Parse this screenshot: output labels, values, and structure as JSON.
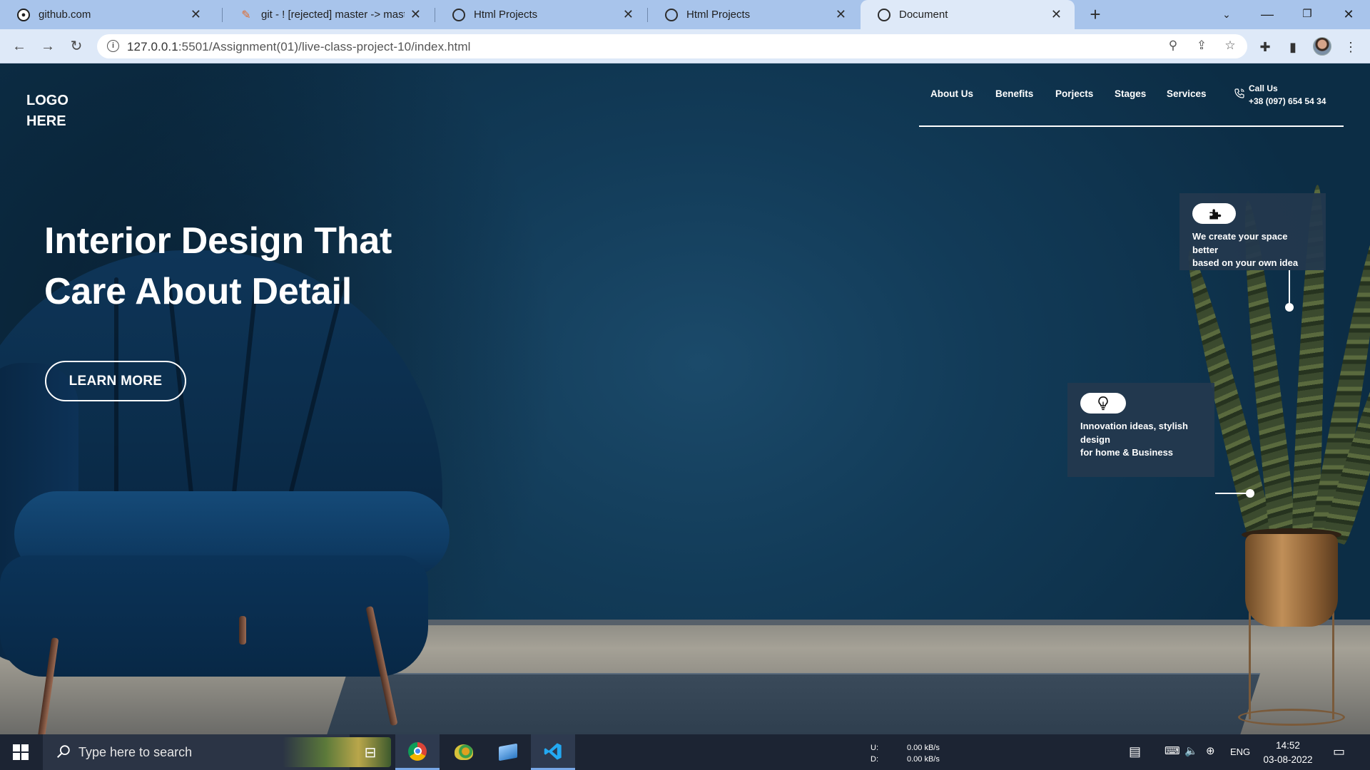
{
  "browser": {
    "tabs": [
      {
        "title": "github.com",
        "icon": "github-icon",
        "active": false
      },
      {
        "title": "git - ! [rejected] master -> maste",
        "icon": "git-icon",
        "active": false
      },
      {
        "title": "Html Projects",
        "icon": "globe-icon",
        "active": false
      },
      {
        "title": "Html Projects",
        "icon": "globe-icon",
        "active": false
      },
      {
        "title": "Document",
        "icon": "globe-icon",
        "active": true
      }
    ],
    "url_host": "127.0.0.1",
    "url_rest": ":5501/Assignment(01)/live-class-project-10/index.html"
  },
  "site": {
    "logo_line1": "LOGO",
    "logo_line2": "HERE",
    "nav": [
      "About Us",
      "Benefits",
      "Porjects",
      "Stages",
      "Services"
    ],
    "call_label": "Call Us",
    "call_number": "+38 (097) 654 54 34",
    "hero_title_line1": "Interior Design That",
    "hero_title_line2": "Care About Detail",
    "cta_label": "LEARN MORE",
    "cards": [
      {
        "icon": "puzzle-icon",
        "line1": "We create your space better",
        "line2": "based on your own idea"
      },
      {
        "icon": "lightbulb-icon",
        "line1": "Innovation ideas, stylish",
        "line2": "design",
        "line3": "for home & Business"
      }
    ]
  },
  "taskbar": {
    "search_placeholder": "Type here to search",
    "net_up_label": "U:",
    "net_up": "0.00 kB/s",
    "net_down_label": "D:",
    "net_down": "0.00 kB/s",
    "language": "ENG",
    "time": "14:52",
    "date": "03-08-2022"
  },
  "colors": {
    "tab_strip": "#a8c4eb",
    "toolbar": "#dee9f8",
    "hero_bg": "#123b58",
    "card_bg": "#24384e",
    "taskbar": "#1c2433"
  }
}
